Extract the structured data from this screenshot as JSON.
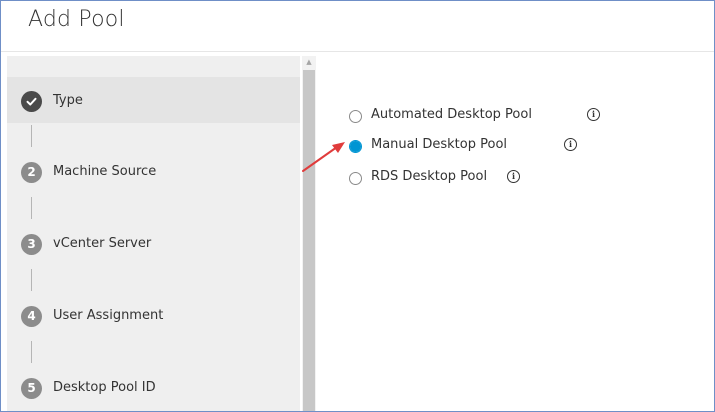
{
  "dialog": {
    "title": "Add Pool"
  },
  "wizard": {
    "steps": [
      {
        "number": "✓",
        "label": "Type",
        "active": true
      },
      {
        "number": "2",
        "label": "Machine Source"
      },
      {
        "number": "3",
        "label": "vCenter Server"
      },
      {
        "number": "4",
        "label": "User Assignment"
      },
      {
        "number": "5",
        "label": "Desktop Pool ID"
      }
    ]
  },
  "pool_type": {
    "options": [
      {
        "label": "Automated Desktop Pool",
        "selected": false,
        "info_icon": "info-icon"
      },
      {
        "label": "Manual Desktop Pool",
        "selected": true,
        "info_icon": "info-icon"
      },
      {
        "label": "RDS Desktop Pool",
        "selected": false,
        "info_icon": "info-icon"
      }
    ],
    "selected_value": "Manual Desktop Pool"
  },
  "colors": {
    "accent": "#0095d3",
    "annotation_arrow": "#e03c3c",
    "frame_border": "#6f8fc7"
  },
  "icons": {
    "check": "check-icon",
    "info": "info-icon",
    "scroll_up": "scroll-up-arrow-icon",
    "annotation": "annotation-arrow"
  }
}
